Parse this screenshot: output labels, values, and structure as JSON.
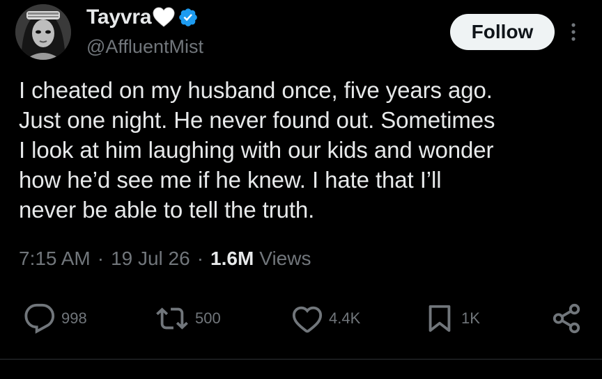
{
  "author": {
    "display_name": "Tayvra",
    "handle": "@AffluentMist",
    "verified": true,
    "name_emoji": "white-heart-icon"
  },
  "follow_button": {
    "label": "Follow"
  },
  "tweet": {
    "text": "I cheated on my husband once, five years ago.\nJust one night. He never found out. Sometimes\nI look at him laughing with our kids and wonder\nhow he’d see me if he knew. I hate that I’ll\nnever be able to tell the truth."
  },
  "meta": {
    "time": "7:15 AM",
    "separator": "·",
    "date": "19 Jul 26",
    "views_count": "1.6M",
    "views_label": "Views"
  },
  "actions": {
    "replies": "998",
    "reposts": "500",
    "likes": "4.4K",
    "bookmarks": "1K"
  },
  "colors": {
    "background": "#000000",
    "text_primary": "#e7e9ea",
    "text_secondary": "#71767b",
    "verified_blue": "#1d9bf0",
    "follow_bg": "#eff3f4",
    "divider": "#2f3336"
  }
}
